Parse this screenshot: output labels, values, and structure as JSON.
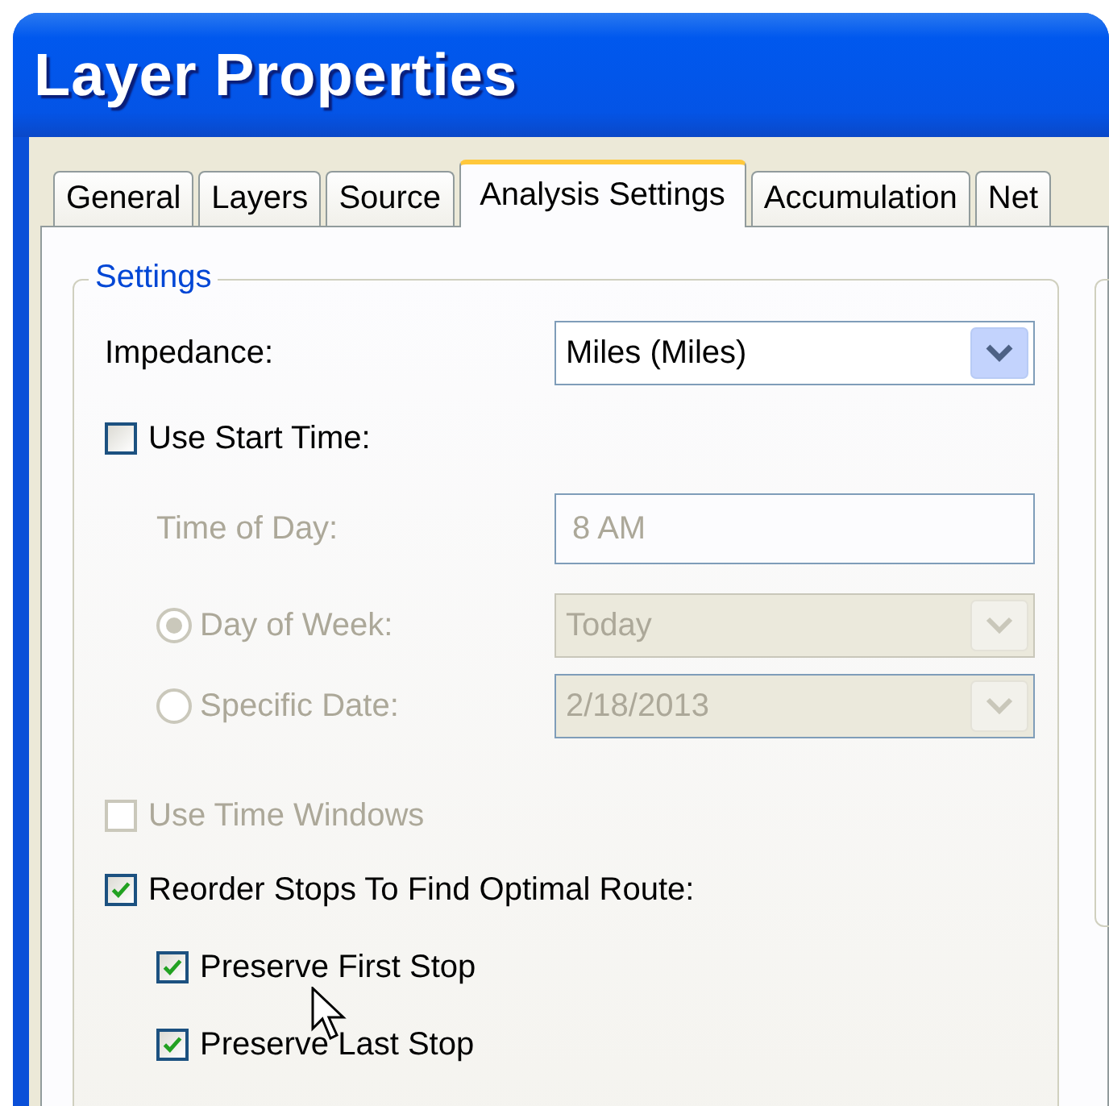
{
  "window": {
    "title": "Layer Properties"
  },
  "tabs": [
    {
      "label": "General",
      "selected": false
    },
    {
      "label": "Layers",
      "selected": false
    },
    {
      "label": "Source",
      "selected": false
    },
    {
      "label": "Analysis Settings",
      "selected": true
    },
    {
      "label": "Accumulation",
      "selected": false
    },
    {
      "label": "Net",
      "selected": false
    }
  ],
  "settings": {
    "legend": "Settings",
    "impedance": {
      "label": "Impedance:",
      "value": "Miles (Miles)"
    },
    "use_start_time": {
      "label": "Use Start Time:",
      "checked": false
    },
    "time_of_day": {
      "label": "Time of Day:",
      "value": "8 AM",
      "disabled": true
    },
    "day_of_week": {
      "label": "Day of Week:",
      "value": "Today",
      "selected": true,
      "disabled": true
    },
    "specific_date": {
      "label": "Specific Date:",
      "value": "2/18/2013",
      "selected": false,
      "disabled": true
    },
    "use_time_windows": {
      "label": "Use Time Windows",
      "checked": false,
      "disabled": true
    },
    "reorder_stops": {
      "label": "Reorder Stops To Find Optimal Route:",
      "checked": true,
      "children": [
        {
          "label": "Preserve First Stop",
          "checked": true
        },
        {
          "label": "Preserve Last Stop",
          "checked": true
        }
      ]
    }
  }
}
